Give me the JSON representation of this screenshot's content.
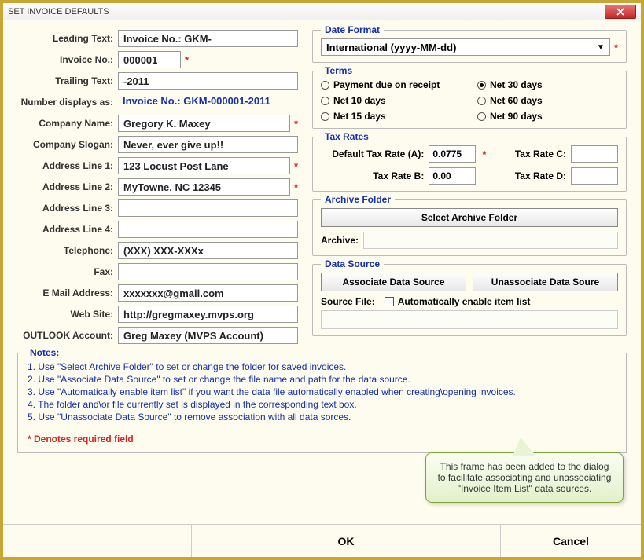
{
  "window": {
    "title": "SET INVOICE DEFAULTS"
  },
  "left": {
    "leading_text_label": "Leading Text:",
    "leading_text": "Invoice No.: GKM-",
    "invoice_no_label": "Invoice No.:",
    "invoice_no": "000001",
    "trailing_text_label": "Trailing Text:",
    "trailing_text": "-2011",
    "display_label": "Number displays as:",
    "display_value": "Invoice No.: GKM-000001-2011",
    "company_name_label": "Company  Name:",
    "company_name": "Gregory K. Maxey",
    "slogan_label": "Company Slogan:",
    "slogan": "Never, ever give up!!",
    "addr1_label": "Address Line 1:",
    "addr1": "123 Locust Post Lane",
    "addr2_label": "Address Line 2:",
    "addr2": "MyTowne, NC 12345",
    "addr3_label": "Address Line 3:",
    "addr3": "",
    "addr4_label": "Address Line 4:",
    "addr4": "",
    "tel_label": "Telephone:",
    "tel": "(XXX) XXX-XXXx",
    "fax_label": "Fax:",
    "fax": "",
    "email_label": "E Mail Address:",
    "email": "xxxxxxx@gmail.com",
    "web_label": "Web Site:",
    "web": "http://gregmaxey.mvps.org",
    "outlook_label": "OUTLOOK Account:",
    "outlook": "Greg Maxey (MVPS Account)"
  },
  "date_format": {
    "legend": "Date Format",
    "selected": "International (yyyy-MM-dd)"
  },
  "terms": {
    "legend": "Terms",
    "options": {
      "o1": "Payment due on receipt",
      "o2": "Net 30 days",
      "o3": "Net 10 days",
      "o4": "Net 60 days",
      "o5": "Net 15 days",
      "o6": "Net 90 days"
    },
    "selected": "Net 30 days"
  },
  "tax": {
    "legend": "Tax Rates",
    "rate_a_label": "Default Tax Rate (A):",
    "rate_a": "0.0775",
    "rate_b_label": "Tax Rate B:",
    "rate_b": "0.00",
    "rate_c_label": "Tax Rate C:",
    "rate_c": "",
    "rate_d_label": "Tax Rate D:",
    "rate_d": ""
  },
  "archive": {
    "legend": "Archive Folder",
    "button": "Select Archive Folder",
    "label": "Archive:",
    "path": ""
  },
  "datasource": {
    "legend": "Data Source",
    "assoc_btn": "Associate Data Source",
    "unassoc_btn": "Unassociate Data Soure",
    "source_label": "Source File:",
    "auto_label": "Automatically enable item list",
    "source_path": ""
  },
  "notes": {
    "legend": "Notes:",
    "n1": "1. Use \"Select Archive Folder\" to set or change the folder for saved invoices.",
    "n2": "2. Use \"Associate Data Source\" to set or change the file name and path for the data source.",
    "n3": "3. Use \"Automatically enable item list\" if you want the data file automatically enabled when creating\\opening invoices.",
    "n4": "4. The folder and\\or file currently set is displayed in the corresponding text box.",
    "n5": "5. Use \"Unassociate Data Source\" to remove association with all data sorces.",
    "req": "*  Denotes required field"
  },
  "callout": {
    "text": "This frame has been added to the dialog to facilitate associating and unassociating \"Invoice Item List\" data sources."
  },
  "buttons": {
    "ok": "OK",
    "cancel": "Cancel"
  },
  "star": "*"
}
